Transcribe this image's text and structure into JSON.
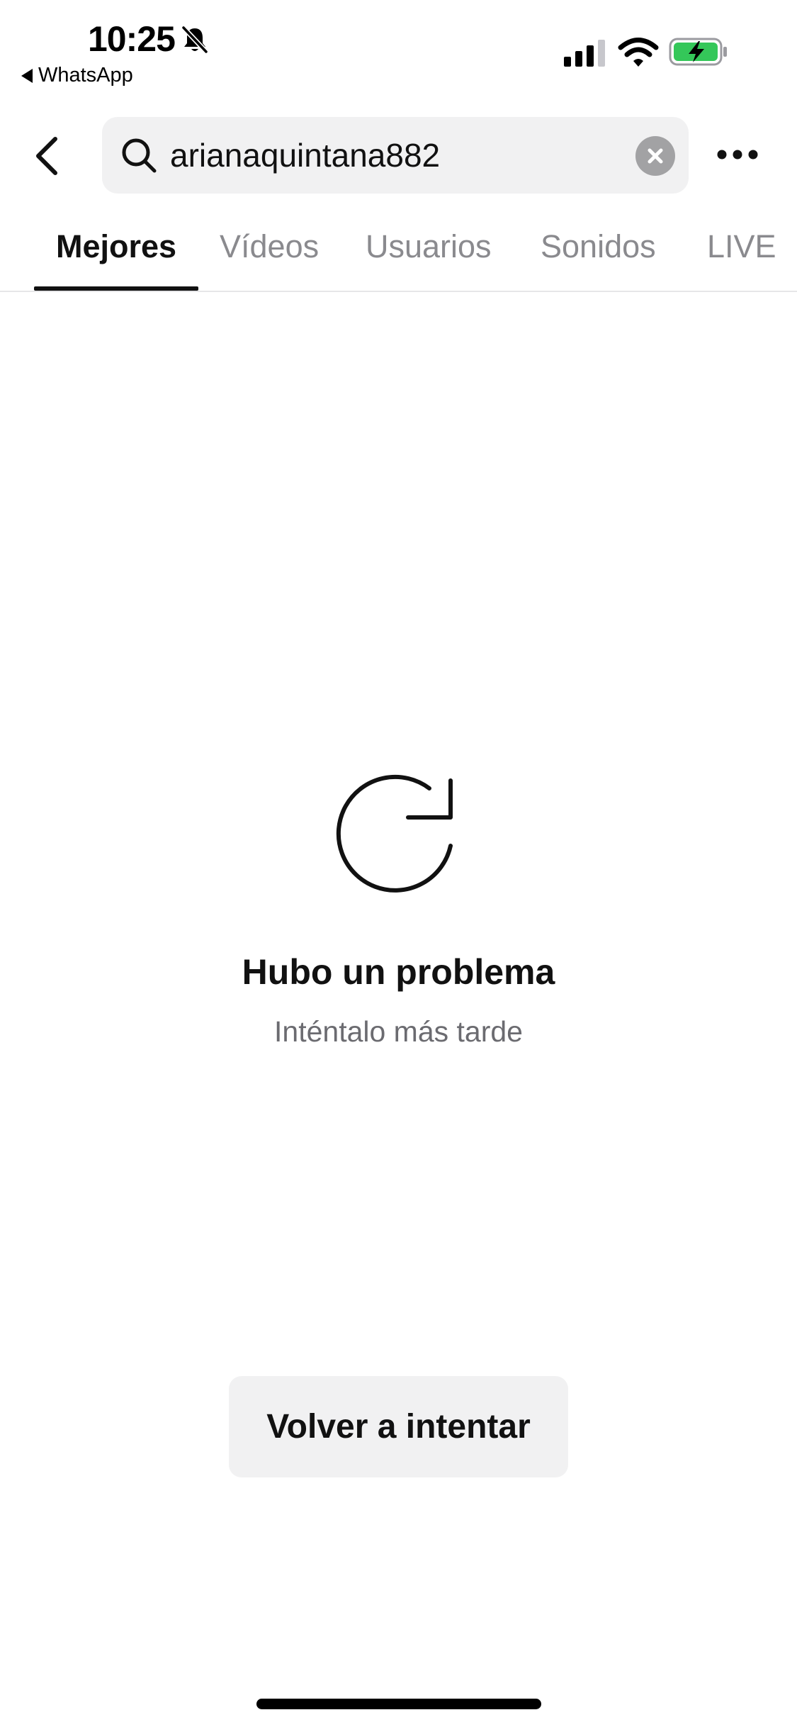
{
  "status_bar": {
    "time": "10:25",
    "back_app_label": "WhatsApp",
    "icons": [
      "bell-slash-icon",
      "cellular-signal-icon",
      "wifi-icon",
      "battery-charging-icon"
    ],
    "battery_color": "#34c759"
  },
  "header": {
    "back_icon": "chevron-left-icon",
    "search": {
      "value": "arianaquintana882",
      "icon": "search-icon",
      "clear_icon": "clear-x-icon"
    },
    "more_icon": "more-horizontal-icon"
  },
  "tabs": [
    {
      "label": "Mejores",
      "active": true
    },
    {
      "label": "Vídeos",
      "active": false
    },
    {
      "label": "Usuarios",
      "active": false
    },
    {
      "label": "Sonidos",
      "active": false
    },
    {
      "label": "LIVE",
      "active": false
    }
  ],
  "error_state": {
    "icon": "refresh-icon",
    "title": "Hubo un problema",
    "subtitle": "Inténtalo más tarde",
    "retry_label": "Volver a intentar"
  },
  "colors": {
    "accent_text": "#111111",
    "inactive_tab": "#8a8a8e",
    "surface": "#f1f1f2"
  }
}
